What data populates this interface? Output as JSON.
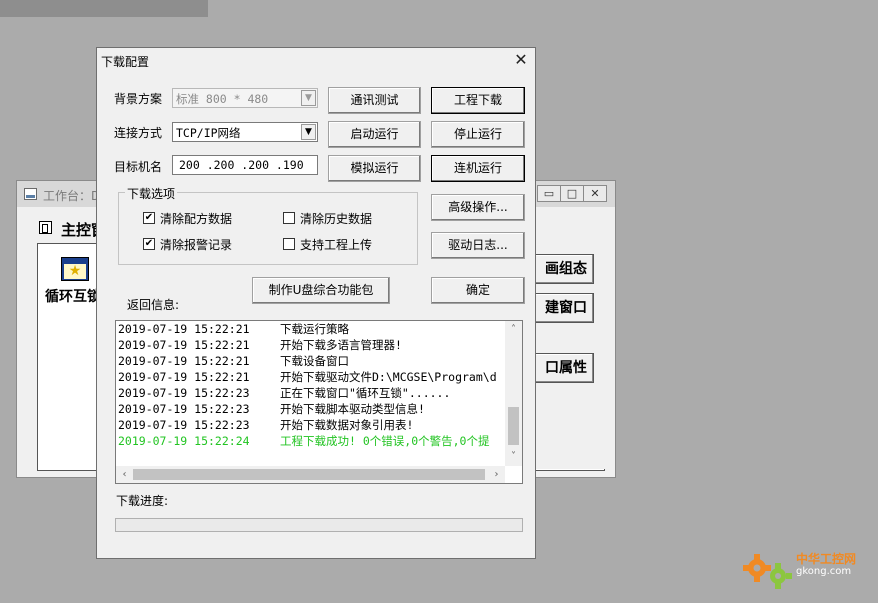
{
  "background_window": {
    "title": "工作台：D",
    "tab_label": "主控窗",
    "window_item_label": "循环互锁",
    "side_buttons": [
      "画组态",
      "建窗口",
      "口属性"
    ]
  },
  "dialog": {
    "title": "下载配置",
    "close_glyph": "✕",
    "background_scheme": {
      "label": "背景方案",
      "value": "标准 800 * 480"
    },
    "connection_mode": {
      "label": "连接方式",
      "value": "TCP/IP网络"
    },
    "target_machine": {
      "label": "目标机名",
      "value": "200 .200 .200 .190"
    },
    "buttons": {
      "comm_test": "通讯测试",
      "project_download": "工程下载",
      "start_run": "启动运行",
      "stop_run": "停止运行",
      "simulate_run": "模拟运行",
      "online_run": "连机运行",
      "advanced": "高级操作...",
      "driver_log": "驱动日志...",
      "make_usb_package": "制作U盘综合功能包",
      "ok": "确定"
    },
    "download_options": {
      "label": "下载选项",
      "items": [
        {
          "label": "清除配方数据",
          "checked": true
        },
        {
          "label": "清除历史数据",
          "checked": false
        },
        {
          "label": "清除报警记录",
          "checked": true
        },
        {
          "label": "支持工程上传",
          "checked": false
        }
      ]
    },
    "return_info_label": "返回信息:",
    "log": [
      {
        "time": "2019-07-19 15:22:21",
        "message": "下载运行策略",
        "color": "#000000"
      },
      {
        "time": "2019-07-19 15:22:21",
        "message": "开始下载多语言管理器!",
        "color": "#000000"
      },
      {
        "time": "2019-07-19 15:22:21",
        "message": "下载设备窗口",
        "color": "#000000"
      },
      {
        "time": "2019-07-19 15:22:21",
        "message": "开始下载驱动文件D:\\MCGSE\\Program\\d",
        "color": "#000000"
      },
      {
        "time": "2019-07-19 15:22:23",
        "message": "正在下载窗口\"循环互锁\"......",
        "color": "#000000"
      },
      {
        "time": "2019-07-19 15:22:23",
        "message": "开始下载脚本驱动类型信息!",
        "color": "#000000"
      },
      {
        "time": "2019-07-19 15:22:23",
        "message": "开始下载数据对象引用表!",
        "color": "#000000"
      },
      {
        "time": "2019-07-19 15:22:24",
        "message": "工程下载成功! 0个错误,0个警告,0个提",
        "color": "#22c422"
      }
    ],
    "progress_label": "下载进度:",
    "progress_value": 0
  },
  "watermark": {
    "brand": "中华工控网",
    "url": "gkong.com"
  }
}
